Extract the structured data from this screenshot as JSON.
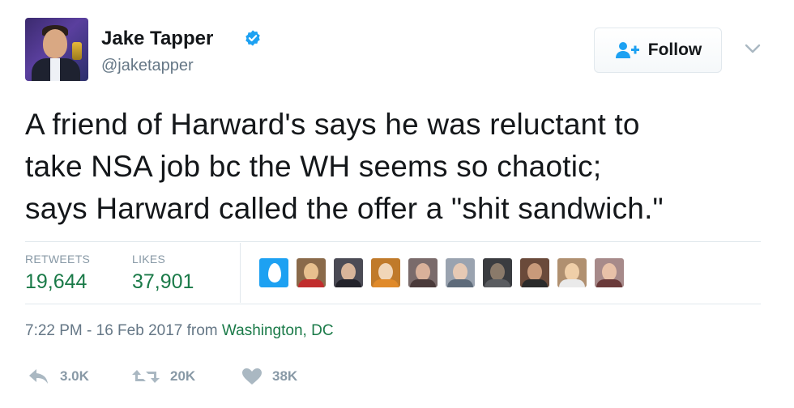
{
  "user": {
    "name": "Jake Tapper",
    "handle": "@jaketapper"
  },
  "follow_button": {
    "label": "Follow"
  },
  "tweet": {
    "lines": [
      "A friend of Harward's says he was reluctant to",
      "take NSA job bc the WH seems so chaotic;",
      "says Harward called the offer a \"shit sandwich.\""
    ]
  },
  "stats": {
    "retweets_label": "RETWEETS",
    "retweets_value": "19,644",
    "likes_label": "LIKES",
    "likes_value": "37,901"
  },
  "timestamp": {
    "time_date": "7:22 PM - 16 Feb 2017",
    "from_word": "from",
    "location": "Washington, DC"
  },
  "actions": {
    "reply_count": "3.0K",
    "retweet_count": "20K",
    "like_count": "38K"
  },
  "colors": {
    "verified": "#1da1f2",
    "stat_value": "#1a7a48",
    "muted": "#8899a6",
    "follow_icon": "#1da1f2"
  },
  "icons": {
    "verified": "verified-badge-icon",
    "follow": "user-plus-icon",
    "caret": "chevron-down-icon",
    "reply": "reply-icon",
    "retweet": "retweet-icon",
    "like": "heart-icon"
  }
}
